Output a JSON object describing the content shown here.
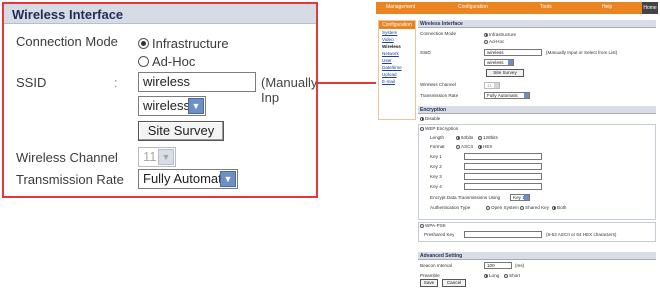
{
  "zoom": {
    "title": "Wireless Interface",
    "connection_mode": {
      "label": "Connection Mode",
      "colon": ":",
      "options": [
        "Infrastructure",
        "Ad-Hoc"
      ],
      "selected": "Infrastructure"
    },
    "ssid": {
      "label": "SSID",
      "colon": ":",
      "value": "wireless",
      "hint": "(Manually Inp",
      "select_value": "wireless",
      "site_survey": "Site Survey"
    },
    "wireless_channel": {
      "label": "Wireless Channel",
      "colon": ":",
      "value": "11"
    },
    "transmission_rate": {
      "label": "Transmission Rate",
      "colon": ":",
      "value": "Fully Automatic"
    }
  },
  "nav": {
    "items": [
      "Management",
      "Configuration",
      "Tools",
      "Help"
    ],
    "home": "Home"
  },
  "sidebar": {
    "header": "Configuration",
    "items": [
      "System",
      "Video",
      "Wireless",
      "Network",
      "User",
      "Date/time",
      "Upload",
      "E-mail"
    ],
    "active": "Wireless"
  },
  "wireless": {
    "title": "Wireless Interface",
    "connection_mode_label": "Connection Mode",
    "opt_infra": "Infrastructure",
    "opt_adhoc": "Ad-Hoc",
    "ssid_label": "SSID",
    "ssid_value": "wireless",
    "ssid_hint": "(Manually Input or Select from List)",
    "ssid_select": "wireless",
    "site_survey": "Site Survey",
    "channel_label": "Wireless Channel",
    "channel_value": "11",
    "rate_label": "Transmission Rate",
    "rate_value": "Fully Automatic"
  },
  "encryption": {
    "title": "Encryption",
    "disable": "Disable",
    "wep": "WEP Encryption",
    "length_label": "Length",
    "len_64": "64bits",
    "len_128": "128bits",
    "format_label": "Format",
    "fmt_ascii": "ASCII",
    "fmt_hex": "HEX",
    "keys": [
      "Key 1",
      "Key 2",
      "Key 3",
      "Key 4"
    ],
    "encrypt_label": "Encrypt Data Transmissions Using",
    "encrypt_value": "Key 1",
    "auth_label": "Authentication Type",
    "auth_open": "Open System",
    "auth_shared": "Shared Key",
    "auth_both": "Both",
    "wpa": "WPA-PSK",
    "preshared_label": "Preshared Key",
    "preshared_hint": "(8-63 ASCII or 64 HEX characters)"
  },
  "advanced": {
    "title": "Advanced Setting",
    "beacon_label": "Beacon Interval",
    "beacon_value": "100",
    "beacon_unit": "(ms)",
    "preamble_label": "Preamble",
    "preamble_long": "Long",
    "preamble_short": "Short"
  },
  "buttons": {
    "save": "Save",
    "cancel": "Cancel"
  },
  "colors": {
    "accent": "#e98420",
    "callout": "#e23a3a",
    "header_band": "#d6dbe5"
  }
}
